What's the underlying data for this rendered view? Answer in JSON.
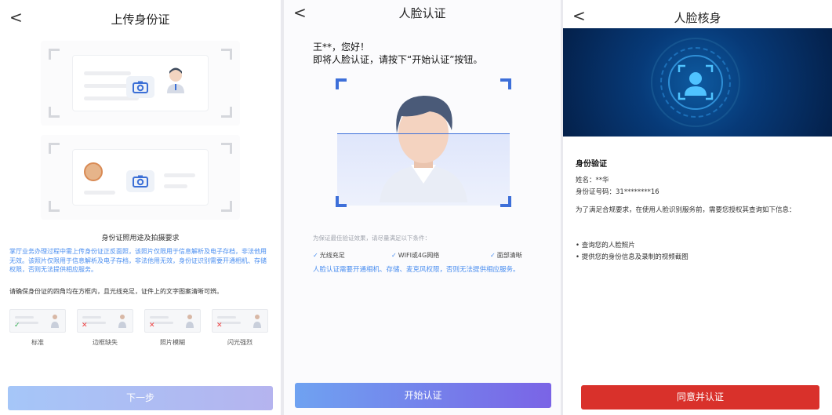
{
  "screen1": {
    "back_icon": "chevron-left-icon",
    "title": "上传身份证",
    "section_title": "身份证照用途及拍摄要求",
    "blue_note": "掌厅业务办理过程中需上传身份证正反面照，该照片仅限用于信息解析及电子存档，非法他用无效。该照片仅限用于信息解析及电子存档，非法他用无效，身份证识别需要开通相机、存储权限，否则无法提供相应服务。",
    "dark_note": "请确保身份证的四角均在方框内，且光线充足，证件上的文字图案清晰可辨。",
    "samples": [
      {
        "label": "标准",
        "mark": "✓"
      },
      {
        "label": "边框缺失",
        "mark": "✕"
      },
      {
        "label": "照片模糊",
        "mark": "✕"
      },
      {
        "label": "闪光强烈",
        "mark": "✕"
      }
    ],
    "next_button": "下一步"
  },
  "screen2": {
    "back_icon": "chevron-left-icon",
    "title": "人脸认证",
    "greeting_line1": "王**，您好！",
    "greeting_line2": "即将人脸认证，请按下“开始认证”按钮。",
    "condition_note": "为保证最佳验证效果，请尽量满足以下条件：",
    "conditions": [
      "光线充足",
      "WIFI或4G网络",
      "面部清晰"
    ],
    "permission_note": "人脸认证需要开通相机、存储、麦克风权限，否则无法提供相应服务。",
    "start_button": "开始认证"
  },
  "screen3": {
    "back_icon": "chevron-left-icon",
    "title": "人脸核身",
    "verify_title": "身份验证",
    "name_line": "姓名：**华",
    "id_line": "身份证号码：31********16",
    "consent_text": "为了满足合规要求，在使用人脸识别服务前，需要您授权其查询如下信息：",
    "bullets": [
      "查询您的人脸照片",
      "提供您的身份信息及录制的视频截图"
    ],
    "agree_button": "同意并认证"
  },
  "colors": {
    "primary_blue": "#4a8ef0",
    "agree_red": "#d9312b",
    "frame_blue": "#3d6fd9"
  }
}
